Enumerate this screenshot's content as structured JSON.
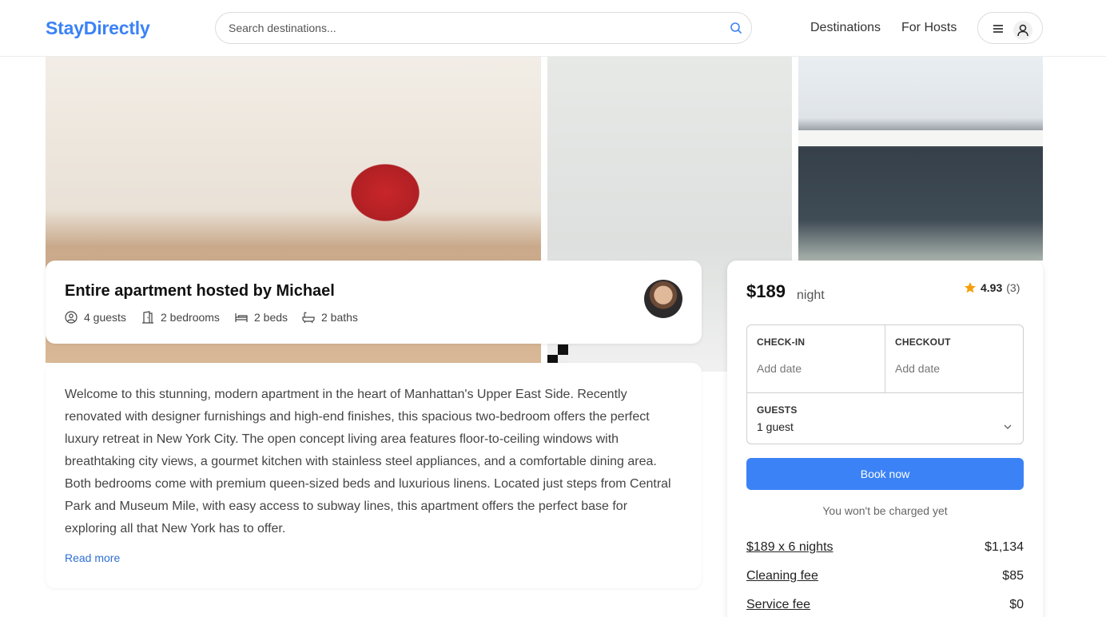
{
  "header": {
    "logo": "StayDirectly",
    "search_placeholder": "Search destinations...",
    "nav": {
      "destinations": "Destinations",
      "hosts": "For Hosts"
    }
  },
  "listing": {
    "title": "Entire apartment hosted by Michael",
    "features": {
      "guests": "4 guests",
      "bedrooms": "2 bedrooms",
      "beds": "2 beds",
      "baths": "2 baths"
    },
    "description": "Welcome to this stunning, modern apartment in the heart of Manhattan's Upper East Side. Recently renovated with designer furnishings and high-end finishes, this spacious two-bedroom offers the perfect luxury retreat in New York City. The open concept living area features floor-to-ceiling windows with breathtaking city views, a gourmet kitchen with stainless steel appliances, and a comfortable dining area. Both bedrooms come with premium queen-sized beds and luxurious linens. Located just steps from Central Park and Museum Mile, with easy access to subway lines, this apartment offers the perfect base for exploring all that New York has to offer.",
    "read_more": "Read more"
  },
  "booking": {
    "price": "$189",
    "per": "night",
    "rating": "4.93",
    "review_count": "(3)",
    "checkin_label": "CHECK-IN",
    "checkin_value": "Add date",
    "checkout_label": "CHECKOUT",
    "checkout_value": "Add date",
    "guests_label": "GUESTS",
    "guests_value": "1 guest",
    "book_label": "Book now",
    "no_charge": "You won't be charged yet",
    "fees": [
      {
        "label": "$189 x 6 nights",
        "amount": "$1,134"
      },
      {
        "label": "Cleaning fee",
        "amount": "$85"
      },
      {
        "label": "Service fee",
        "amount": "$0"
      }
    ]
  },
  "colors": {
    "accent": "#3b82f6",
    "star": "#f59e0b"
  },
  "icons": [
    "search-icon",
    "menu-icon",
    "user-icon",
    "guests-icon",
    "bedroom-icon",
    "bed-icon",
    "bath-icon",
    "star-icon",
    "chevron-down-icon"
  ]
}
